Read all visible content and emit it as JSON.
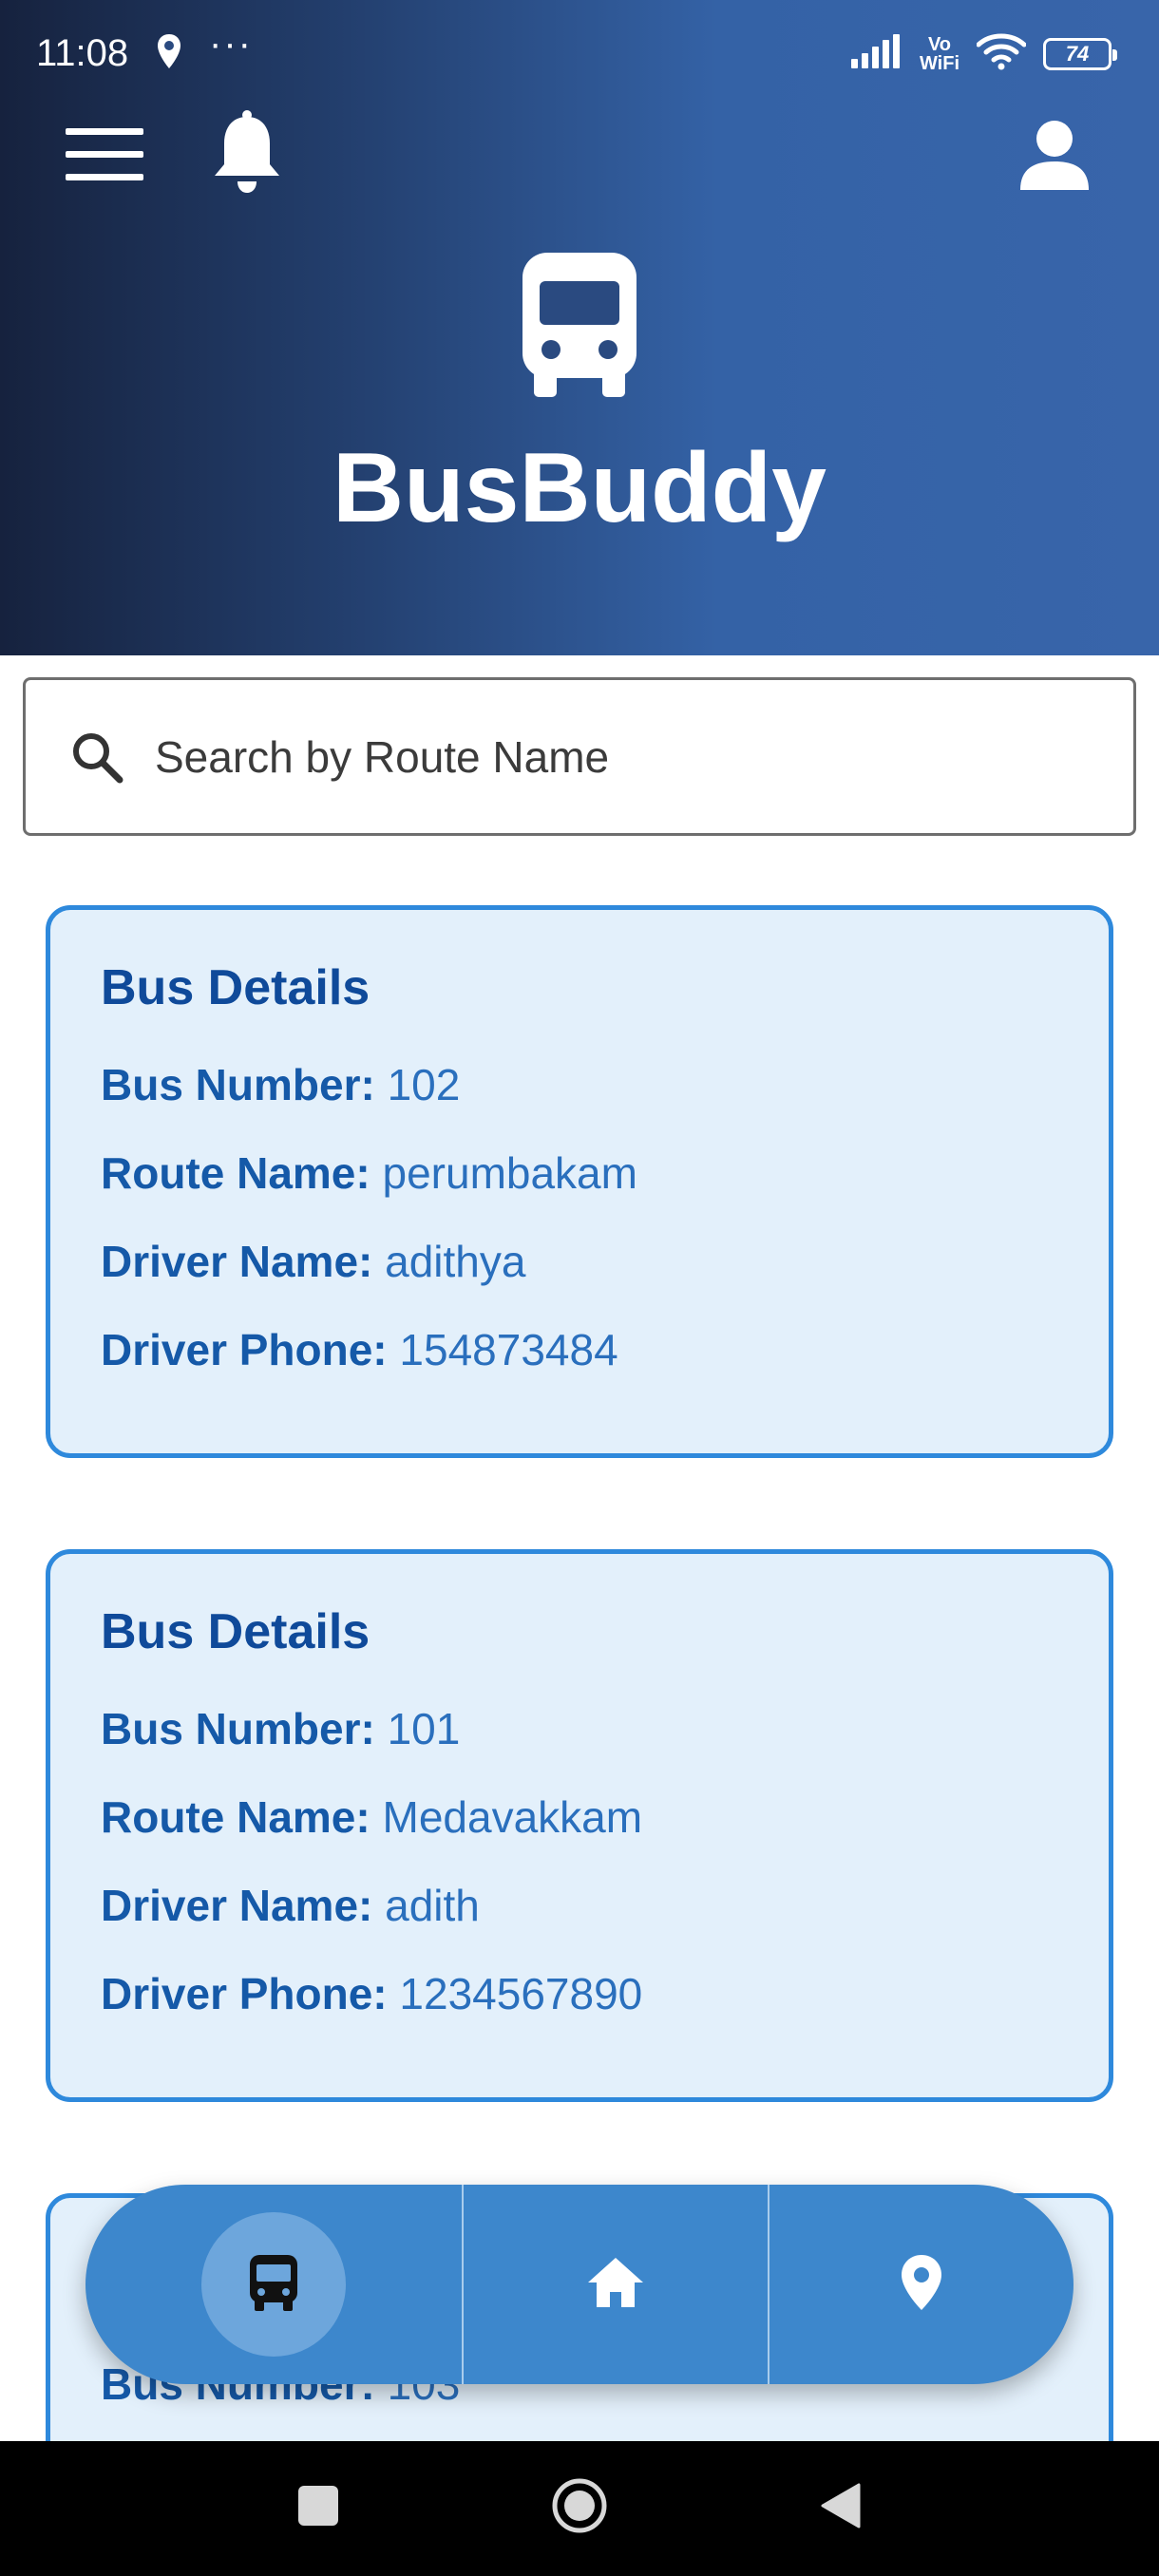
{
  "status_bar": {
    "time": "11:08",
    "more": "···",
    "network_label_top": "Vo",
    "network_label_bottom": "WiFi",
    "battery": "74"
  },
  "header": {
    "app_title": "BusBuddy"
  },
  "search": {
    "placeholder": "Search by Route Name"
  },
  "cards": [
    {
      "title": "Bus Details",
      "bus_number_label": "Bus Number:",
      "bus_number": "102",
      "route_label": "Route Name:",
      "route": "perumbakam",
      "driver_label": "Driver Name:",
      "driver": "adithya",
      "phone_label": "Driver Phone:",
      "phone": "154873484"
    },
    {
      "title": "Bus Details",
      "bus_number_label": "Bus Number:",
      "bus_number": "101",
      "route_label": "Route Name:",
      "route": "Medavakkam",
      "driver_label": "Driver Name:",
      "driver": "adith",
      "phone_label": "Driver Phone:",
      "phone": "1234567890"
    },
    {
      "bus_number_label": "Bus Number:",
      "bus_number": "103"
    }
  ],
  "bottom_nav": {
    "items": [
      "bus-icon",
      "home-icon",
      "location-pin-icon"
    ],
    "active": "bus-icon"
  },
  "colors": {
    "header_start": "#16223e",
    "header_end": "#3865aa",
    "card_bg": "#e3f0fb",
    "card_border": "#2e89dc",
    "nav_bg": "#3d87cc"
  }
}
